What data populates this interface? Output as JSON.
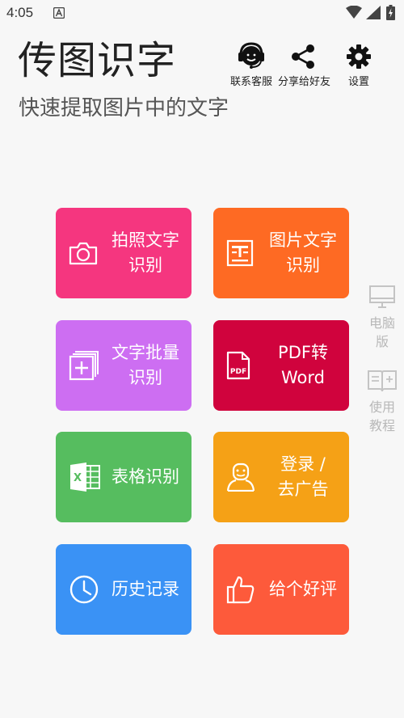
{
  "status": {
    "time": "4:05"
  },
  "app": {
    "title": "传图识字",
    "subtitle": "快速提取图片中的文字"
  },
  "top_actions": [
    {
      "label": "联系客服",
      "icon": "customer-service-icon"
    },
    {
      "label": "分享给好友",
      "icon": "share-icon"
    },
    {
      "label": "设置",
      "icon": "gear-icon"
    }
  ],
  "tiles": [
    {
      "lines": [
        "拍照文字",
        "识别"
      ],
      "icon": "camera-icon",
      "color": "#f5367f"
    },
    {
      "lines": [
        "图片文字",
        "识别"
      ],
      "icon": "document-image-icon",
      "color": "#fe6a23"
    },
    {
      "lines": [
        "文字批量",
        "识别"
      ],
      "icon": "batch-add-icon",
      "color": "#cd6ef2"
    },
    {
      "lines": [
        "PDF转",
        "Word"
      ],
      "icon": "pdf-icon",
      "color": "#d0033d"
    },
    {
      "lines": [
        "表格识别"
      ],
      "icon": "excel-icon",
      "color": "#56bd5f"
    },
    {
      "lines": [
        "登录 /",
        "去广告"
      ],
      "icon": "user-icon",
      "color": "#f5a116"
    },
    {
      "lines": [
        "历史记录"
      ],
      "icon": "clock-icon",
      "color": "#3a92f5"
    },
    {
      "lines": [
        "给个好评"
      ],
      "icon": "thumbs-up-icon",
      "color": "#fd5a3b"
    }
  ],
  "side_links": [
    {
      "lines": [
        "电脑",
        "版"
      ],
      "icon": "monitor-icon"
    },
    {
      "lines": [
        "使用",
        "教程"
      ],
      "icon": "book-icon"
    }
  ]
}
